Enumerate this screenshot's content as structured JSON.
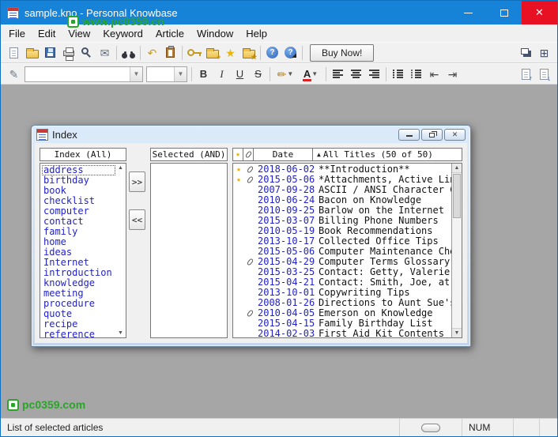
{
  "app": {
    "title": "sample.kno - Personal Knowbase",
    "watermark_top": "www.pc0359.cn",
    "watermark_bottom": "pc0359.com"
  },
  "menu": {
    "items": [
      "File",
      "Edit",
      "View",
      "Keyword",
      "Article",
      "Window",
      "Help"
    ]
  },
  "toolbar_main": {
    "buy_now_label": "Buy Now!",
    "buttons": [
      {
        "name": "new-article",
        "kind": "css",
        "cls": "pagei"
      },
      {
        "name": "open-file",
        "kind": "css",
        "cls": "folder"
      },
      {
        "name": "save",
        "kind": "css",
        "cls": "disk"
      },
      {
        "name": "print",
        "kind": "css",
        "cls": "printer"
      },
      {
        "name": "print-preview",
        "kind": "css",
        "cls": "mag"
      },
      {
        "name": "email-article",
        "kind": "glyph",
        "glyph": "✉",
        "color": "#5a6b7d"
      },
      {
        "kind": "sep"
      },
      {
        "name": "find",
        "kind": "css",
        "cls": "binoc"
      },
      {
        "kind": "sep"
      },
      {
        "name": "undo",
        "kind": "glyph",
        "glyph": "↶",
        "color": "#c79a1e"
      },
      {
        "name": "paste",
        "kind": "css",
        "cls": "clipboard"
      },
      {
        "kind": "sep"
      },
      {
        "name": "attach-keywords",
        "kind": "css",
        "cls": "key"
      },
      {
        "name": "new-keyword",
        "kind": "css",
        "cls": "folder",
        "badge": "+"
      },
      {
        "name": "flag-article",
        "kind": "glyph",
        "glyph": "★",
        "color": "#e8b900"
      },
      {
        "name": "attachments",
        "kind": "css",
        "cls": "folder",
        "badge": "★"
      },
      {
        "kind": "sep"
      },
      {
        "name": "help",
        "kind": "css",
        "cls": "helpc",
        "badge": "?"
      },
      {
        "name": "context-help",
        "kind": "css",
        "cls": "helpc helpp",
        "badge": "?"
      },
      {
        "kind": "sep"
      },
      {
        "name": "buy-now",
        "kind": "buy"
      },
      {
        "kind": "spacer"
      },
      {
        "name": "new-window",
        "kind": "css",
        "cls": "winnew"
      },
      {
        "name": "arrange-windows",
        "kind": "glyph",
        "glyph": "⊞",
        "color": "#44506a"
      }
    ]
  },
  "toolbar_format": {
    "font_family_value": "",
    "font_size_value": "",
    "buttons": [
      {
        "name": "edit-note",
        "kind": "glyph",
        "glyph": "✎",
        "color": "#6b7b8d"
      },
      {
        "name": "font-family",
        "kind": "combo",
        "width": 150
      },
      {
        "name": "font-size",
        "kind": "combo",
        "width": 52
      },
      {
        "kind": "sep"
      },
      {
        "name": "bold",
        "kind": "letter",
        "label": "B",
        "style": "b"
      },
      {
        "name": "italic",
        "kind": "letter",
        "label": "I",
        "style": "i"
      },
      {
        "name": "underline",
        "kind": "letter",
        "label": "U",
        "style": "u"
      },
      {
        "name": "strikethrough",
        "kind": "letter",
        "label": "S",
        "style": "s"
      },
      {
        "kind": "sep"
      },
      {
        "name": "highlight-pen",
        "kind": "dropbtn",
        "glyph": "✏",
        "color": "#b07c20"
      },
      {
        "name": "font-color",
        "kind": "dropbtn",
        "glyph": "A",
        "color": "#222",
        "cls": "colorA"
      },
      {
        "kind": "sep"
      },
      {
        "name": "align-left",
        "kind": "bars",
        "cls": "align-left"
      },
      {
        "name": "align-center",
        "kind": "bars",
        "cls": "align-center"
      },
      {
        "name": "align-right",
        "kind": "bars",
        "cls": "align-right"
      },
      {
        "kind": "sep"
      },
      {
        "name": "numbered-list",
        "kind": "bars",
        "cls": "list-num"
      },
      {
        "name": "bullet-list",
        "kind": "bars",
        "cls": "list-bul"
      },
      {
        "name": "outdent",
        "kind": "glyph",
        "glyph": "⇤",
        "color": "#444"
      },
      {
        "name": "indent",
        "kind": "glyph",
        "glyph": "⇥",
        "color": "#444"
      },
      {
        "kind": "spacer"
      },
      {
        "name": "prev-article",
        "kind": "css",
        "cls": "pagei",
        "badge": "↑"
      },
      {
        "name": "next-article",
        "kind": "css",
        "cls": "pagei",
        "badge": "↓"
      }
    ]
  },
  "index_window": {
    "title": "Index",
    "keywords": {
      "header": "Index (All)",
      "items": [
        "address",
        "birthday",
        "book",
        "checklist",
        "computer",
        "contact",
        "family",
        "home",
        "ideas",
        "Internet",
        "introduction",
        "knowledge",
        "meeting",
        "procedure",
        "quote",
        "recipe",
        "reference"
      ]
    },
    "transfer": {
      "add_label": ">>",
      "remove_label": "<<"
    },
    "selected": {
      "header": "Selected (AND)"
    },
    "articles": {
      "sort_arrow": "▲",
      "date_header": "Date",
      "titles_header": "All Titles (50 of 50)",
      "rows": [
        {
          "star": true,
          "clip": true,
          "date": "2018-06-02",
          "title": "**Introduction**"
        },
        {
          "star": true,
          "clip": true,
          "date": "2015-05-06",
          "title": "*Attachments, Active Links, &"
        },
        {
          "star": false,
          "clip": false,
          "date": "2007-09-28",
          "title": "ASCII / ANSI Character Cod"
        },
        {
          "star": false,
          "clip": false,
          "date": "2010-06-24",
          "title": "Bacon on Knowledge"
        },
        {
          "star": false,
          "clip": false,
          "date": "2010-09-25",
          "title": "Barlow on the Internet"
        },
        {
          "star": false,
          "clip": false,
          "date": "2015-03-07",
          "title": "Billing Phone Numbers"
        },
        {
          "star": false,
          "clip": false,
          "date": "2010-05-19",
          "title": "Book Recommendations"
        },
        {
          "star": false,
          "clip": false,
          "date": "2013-10-17",
          "title": "Collected Office Tips"
        },
        {
          "star": false,
          "clip": false,
          "date": "2015-05-06",
          "title": "Computer Maintenance Chec"
        },
        {
          "star": false,
          "clip": true,
          "date": "2015-04-29",
          "title": "Computer Terms Glossary"
        },
        {
          "star": false,
          "clip": false,
          "date": "2015-03-25",
          "title": "Contact: Getty, Valerie, at Ba"
        },
        {
          "star": false,
          "clip": false,
          "date": "2015-04-21",
          "title": "Contact: Smith, Joe, at Acme"
        },
        {
          "star": false,
          "clip": false,
          "date": "2013-10-01",
          "title": "Copywriting Tips"
        },
        {
          "star": false,
          "clip": false,
          "date": "2008-01-26",
          "title": "Directions to Aunt Sue's"
        },
        {
          "star": false,
          "clip": true,
          "date": "2010-04-05",
          "title": "Emerson on Knowledge"
        },
        {
          "star": false,
          "clip": false,
          "date": "2015-04-15",
          "title": "Family Birthday List"
        },
        {
          "star": false,
          "clip": false,
          "date": "2014-02-03",
          "title": "First Aid Kit Contents"
        }
      ]
    }
  },
  "status_bar": {
    "text": "List of selected articles",
    "num_indicator": "NUM"
  }
}
